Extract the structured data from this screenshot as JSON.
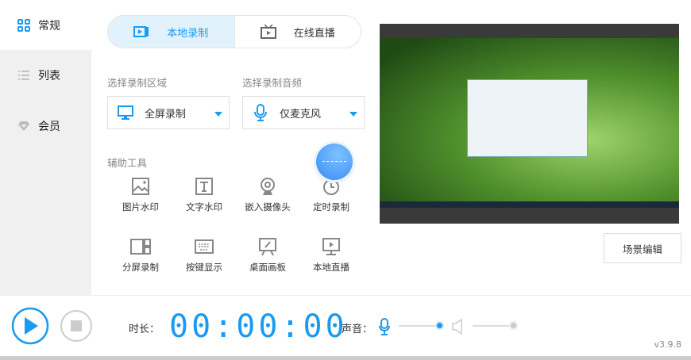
{
  "sidebar": {
    "items": [
      {
        "label": "常规"
      },
      {
        "label": "列表"
      },
      {
        "label": "会员"
      }
    ]
  },
  "tabs": [
    {
      "label": "本地录制"
    },
    {
      "label": "在线直播"
    }
  ],
  "area": {
    "label": "选择录制区域",
    "value": "全屏录制"
  },
  "audio": {
    "label": "选择录制音频",
    "value": "仅麦克风"
  },
  "tools": {
    "title": "辅助工具",
    "items": [
      {
        "label": "图片水印"
      },
      {
        "label": "文字水印"
      },
      {
        "label": "嵌入摄像头"
      },
      {
        "label": "定时录制"
      },
      {
        "label": "分屏录制"
      },
      {
        "label": "按键显示"
      },
      {
        "label": "桌面画板"
      },
      {
        "label": "本地直播"
      }
    ]
  },
  "scene_button": "场景编辑",
  "bottom": {
    "duration_label": "时长：",
    "time": "00:00:00",
    "sound_label": "声音：",
    "mic_volume": 1.0,
    "speaker_volume": 1.0,
    "version": "v3.9.8"
  },
  "colors": {
    "accent": "#1a9bf0"
  }
}
